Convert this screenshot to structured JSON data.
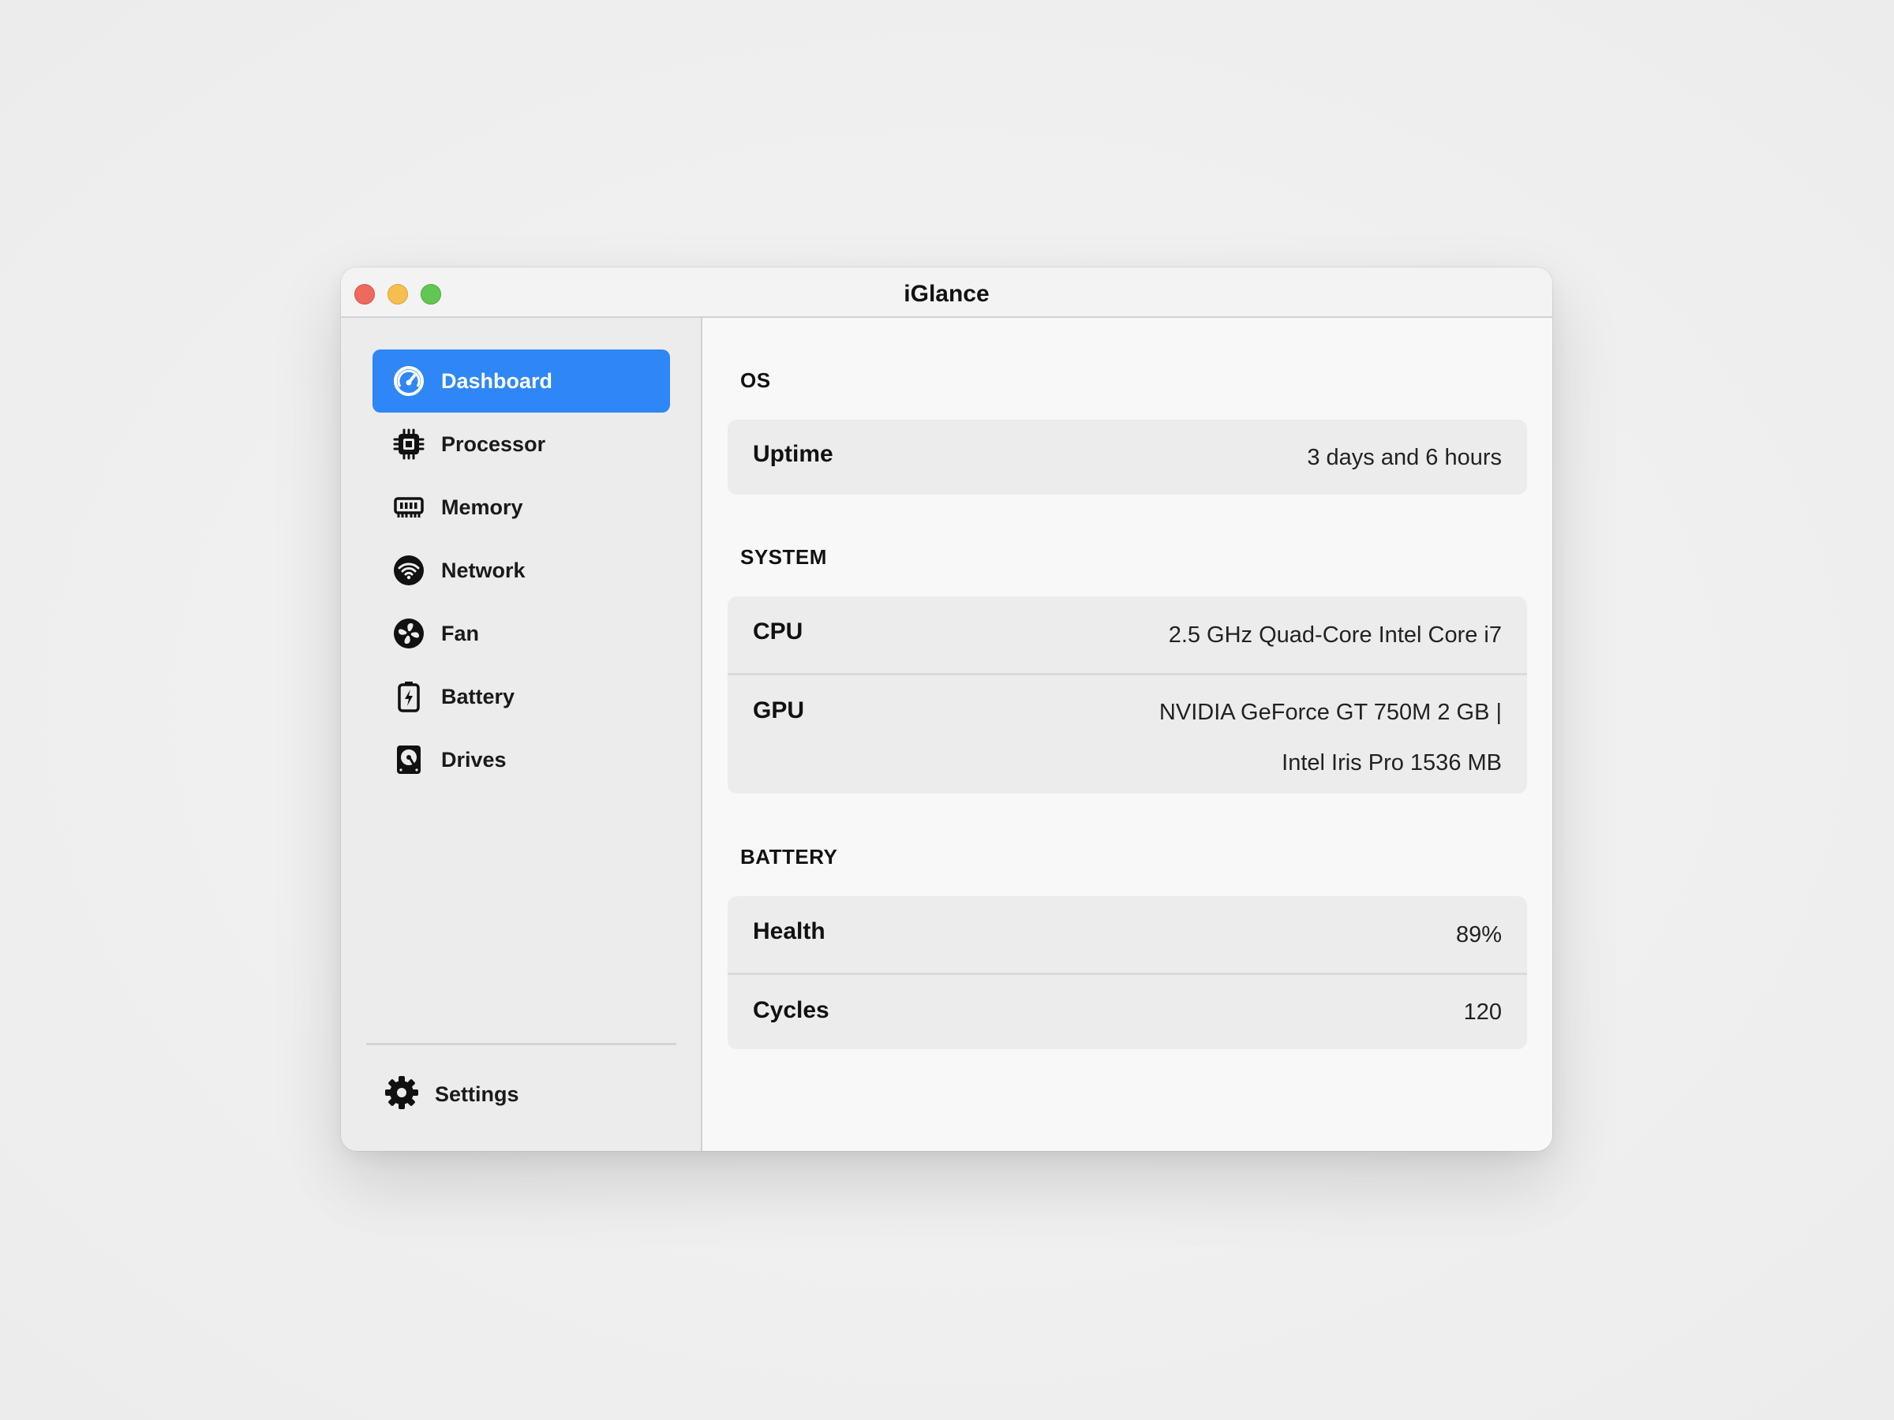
{
  "window": {
    "title": "iGlance"
  },
  "sidebar": {
    "items": [
      {
        "label": "Dashboard",
        "icon": "dashboard-gauge-icon",
        "active": true
      },
      {
        "label": "Processor",
        "icon": "processor-chip-icon",
        "active": false
      },
      {
        "label": "Memory",
        "icon": "memory-ram-icon",
        "active": false
      },
      {
        "label": "Network",
        "icon": "network-wifi-icon",
        "active": false
      },
      {
        "label": "Fan",
        "icon": "fan-icon",
        "active": false
      },
      {
        "label": "Battery",
        "icon": "battery-icon",
        "active": false
      },
      {
        "label": "Drives",
        "icon": "drive-icon",
        "active": false
      }
    ],
    "settings_label": "Settings",
    "settings_icon": "gear-icon"
  },
  "sections": {
    "os": {
      "title": "OS",
      "uptime_key": "Uptime",
      "uptime_value": "3 days and 6 hours"
    },
    "system": {
      "title": "SYSTEM",
      "cpu_key": "CPU",
      "cpu_value": "2.5 GHz Quad-Core Intel Core i7",
      "gpu_key": "GPU",
      "gpu_value_line1": "NVIDIA GeForce GT 750M 2 GB |",
      "gpu_value_line2": "Intel Iris Pro 1536 MB"
    },
    "battery": {
      "title": "BATTERY",
      "health_key": "Health",
      "health_value": "89%",
      "cycles_key": "Cycles",
      "cycles_value": "120"
    }
  },
  "colors": {
    "accent": "#2f86f6",
    "sidebar_bg": "#ececec",
    "main_bg": "#f8f8f8",
    "card_bg": "#ececec",
    "close": "#ec6a5e",
    "minimize": "#f5be4f",
    "zoom": "#62c655"
  }
}
